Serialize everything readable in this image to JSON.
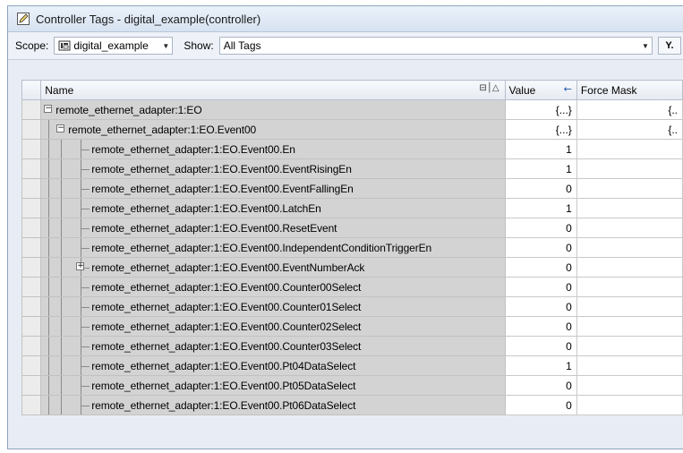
{
  "window": {
    "title": "Controller Tags - digital_example(controller)"
  },
  "toolbar": {
    "scope_label": "Scope:",
    "scope_value": "digital_example",
    "show_label": "Show:",
    "show_value": "All Tags"
  },
  "columns": {
    "name": "Name",
    "value": "Value",
    "force_mask": "Force Mask"
  },
  "rows": [
    {
      "name": "remote_ethernet_adapter:1:EO",
      "value": "{...}",
      "force": "{..",
      "level": 0,
      "expander": "minus"
    },
    {
      "name": "remote_ethernet_adapter:1:EO.Event00",
      "value": "{...}",
      "force": "{..",
      "level": 1,
      "expander": "minus"
    },
    {
      "name": "remote_ethernet_adapter:1:EO.Event00.En",
      "value": "1",
      "force": "",
      "level": 2,
      "expander": "none"
    },
    {
      "name": "remote_ethernet_adapter:1:EO.Event00.EventRisingEn",
      "value": "1",
      "force": "",
      "level": 2,
      "expander": "none"
    },
    {
      "name": "remote_ethernet_adapter:1:EO.Event00.EventFallingEn",
      "value": "0",
      "force": "",
      "level": 2,
      "expander": "none"
    },
    {
      "name": "remote_ethernet_adapter:1:EO.Event00.LatchEn",
      "value": "1",
      "force": "",
      "level": 2,
      "expander": "none"
    },
    {
      "name": "remote_ethernet_adapter:1:EO.Event00.ResetEvent",
      "value": "0",
      "force": "",
      "level": 2,
      "expander": "none"
    },
    {
      "name": "remote_ethernet_adapter:1:EO.Event00.IndependentConditionTriggerEn",
      "value": "0",
      "force": "",
      "level": 2,
      "expander": "none"
    },
    {
      "name": "remote_ethernet_adapter:1:EO.Event00.EventNumberAck",
      "value": "0",
      "force": "",
      "level": 2,
      "expander": "plus"
    },
    {
      "name": "remote_ethernet_adapter:1:EO.Event00.Counter00Select",
      "value": "0",
      "force": "",
      "level": 2,
      "expander": "none"
    },
    {
      "name": "remote_ethernet_adapter:1:EO.Event00.Counter01Select",
      "value": "0",
      "force": "",
      "level": 2,
      "expander": "none"
    },
    {
      "name": "remote_ethernet_adapter:1:EO.Event00.Counter02Select",
      "value": "0",
      "force": "",
      "level": 2,
      "expander": "none"
    },
    {
      "name": "remote_ethernet_adapter:1:EO.Event00.Counter03Select",
      "value": "0",
      "force": "",
      "level": 2,
      "expander": "none"
    },
    {
      "name": "remote_ethernet_adapter:1:EO.Event00.Pt04DataSelect",
      "value": "1",
      "force": "",
      "level": 2,
      "expander": "none"
    },
    {
      "name": "remote_ethernet_adapter:1:EO.Event00.Pt05DataSelect",
      "value": "0",
      "force": "",
      "level": 2,
      "expander": "none"
    },
    {
      "name": "remote_ethernet_adapter:1:EO.Event00.Pt06DataSelect",
      "value": "0",
      "force": "",
      "level": 2,
      "expander": "none"
    }
  ],
  "icons": {
    "title": "pencil-icon",
    "scope": "controller-icon",
    "dropdown": "chevron-down-icon",
    "filter": "filter-icon",
    "sort": "sort-icon",
    "value_arrow": "arrow-left-icon"
  }
}
